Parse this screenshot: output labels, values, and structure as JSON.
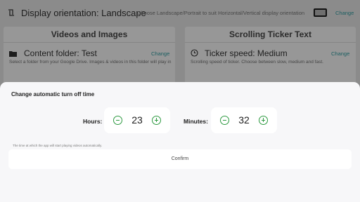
{
  "background": {
    "top": {
      "title": "Display orientation: Landscape",
      "description": "Choose Landscape/Portrait to suit Horizontal/Vertical display orientation",
      "change_label": "Change",
      "icons": {
        "rotate": "rotate-icon",
        "device": "device-landscape-icon"
      }
    },
    "cards": {
      "left": {
        "heading": "Videos and Images",
        "label": "Content folder: Test",
        "change_label": "Change",
        "description": "Select a folder from your Google Drive. Images & videos in this folder will play in",
        "icon": "folder-icon"
      },
      "right": {
        "heading": "Scrolling Ticker Text",
        "label": "Ticker speed: Medium",
        "change_label": "Change",
        "description": "Scrolling speed of ticker. Choose between slow, medium and fast.",
        "icon": "clock-icon"
      }
    }
  },
  "dialog": {
    "title": "Change automatic turn off time",
    "hours": {
      "label": "Hours:",
      "value": "23"
    },
    "minutes": {
      "label": "Minutes:",
      "value": "32"
    },
    "hint": "The time at which the app will start playing videos automatically.",
    "confirm_label": "Confirm",
    "icons": {
      "decrement": "minus-circle-icon",
      "increment": "plus-circle-icon"
    }
  },
  "colors": {
    "accent_green": "#2e9a41",
    "link": "#1b5e61",
    "sheet_bg": "#f7f7f9",
    "scrim": "#8b8b8b"
  }
}
